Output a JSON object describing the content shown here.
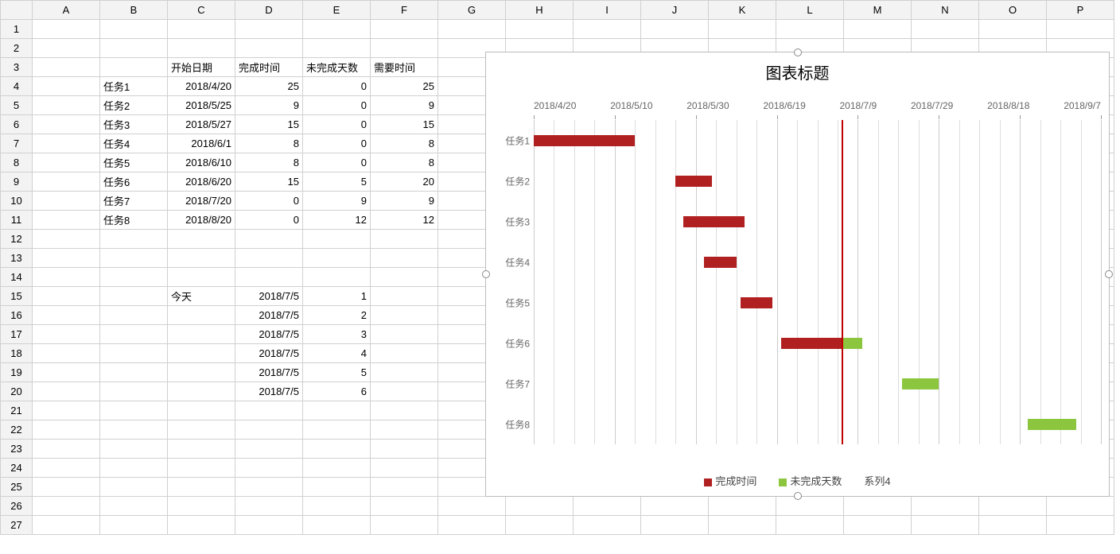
{
  "columns": [
    "A",
    "B",
    "C",
    "D",
    "E",
    "F",
    "G",
    "H",
    "I",
    "J",
    "K",
    "L",
    "M",
    "N",
    "O",
    "P"
  ],
  "numRows": 27,
  "headers": {
    "C3": "开始日期",
    "D3": "完成时间",
    "E3": "未完成天数",
    "F3": "需要时间"
  },
  "tasks": [
    {
      "name": "任务1",
      "start": "2018/4/20",
      "done": 25,
      "remain": 0,
      "need": 25
    },
    {
      "name": "任务2",
      "start": "2018/5/25",
      "done": 9,
      "remain": 0,
      "need": 9
    },
    {
      "name": "任务3",
      "start": "2018/5/27",
      "done": 15,
      "remain": 0,
      "need": 15
    },
    {
      "name": "任务4",
      "start": "2018/6/1",
      "done": 8,
      "remain": 0,
      "need": 8
    },
    {
      "name": "任务5",
      "start": "2018/6/10",
      "done": 8,
      "remain": 0,
      "need": 8
    },
    {
      "name": "任务6",
      "start": "2018/6/20",
      "done": 15,
      "remain": 5,
      "need": 20
    },
    {
      "name": "任务7",
      "start": "2018/7/20",
      "done": 0,
      "remain": 9,
      "need": 9
    },
    {
      "name": "任务8",
      "start": "2018/8/20",
      "done": 0,
      "remain": 12,
      "need": 12
    }
  ],
  "todayBlock": {
    "label": "今天",
    "rows": [
      {
        "date": "2018/7/5",
        "n": 1
      },
      {
        "date": "2018/7/5",
        "n": 2
      },
      {
        "date": "2018/7/5",
        "n": 3
      },
      {
        "date": "2018/7/5",
        "n": 4
      },
      {
        "date": "2018/7/5",
        "n": 5
      },
      {
        "date": "2018/7/5",
        "n": 6
      }
    ]
  },
  "chart_data": {
    "type": "bar",
    "title": "图表标题",
    "xlabel": "",
    "ylabel": "",
    "x_axis_ticks": [
      "2018/4/20",
      "2018/5/10",
      "2018/5/30",
      "2018/6/19",
      "2018/7/9",
      "2018/7/29",
      "2018/8/18",
      "2018/9/7"
    ],
    "x_range_serial": [
      43210,
      43350
    ],
    "categories": [
      "任务1",
      "任务2",
      "任务3",
      "任务4",
      "任务5",
      "任务6",
      "任务7",
      "任务8"
    ],
    "series": [
      {
        "name": "开始日期(offset)",
        "role": "offset",
        "values": [
          43210,
          43245,
          43247,
          43252,
          43261,
          43271,
          43301,
          43332
        ]
      },
      {
        "name": "完成时间",
        "color": "#b02020",
        "values": [
          25,
          9,
          15,
          8,
          8,
          15,
          0,
          0
        ]
      },
      {
        "name": "未完成天数",
        "color": "#8cc63f",
        "values": [
          0,
          0,
          0,
          0,
          0,
          5,
          9,
          12
        ]
      },
      {
        "name": "系列4",
        "values": []
      }
    ],
    "today_line_serial": 43286,
    "legend": [
      "完成时间",
      "未完成天数",
      "系列4"
    ]
  }
}
